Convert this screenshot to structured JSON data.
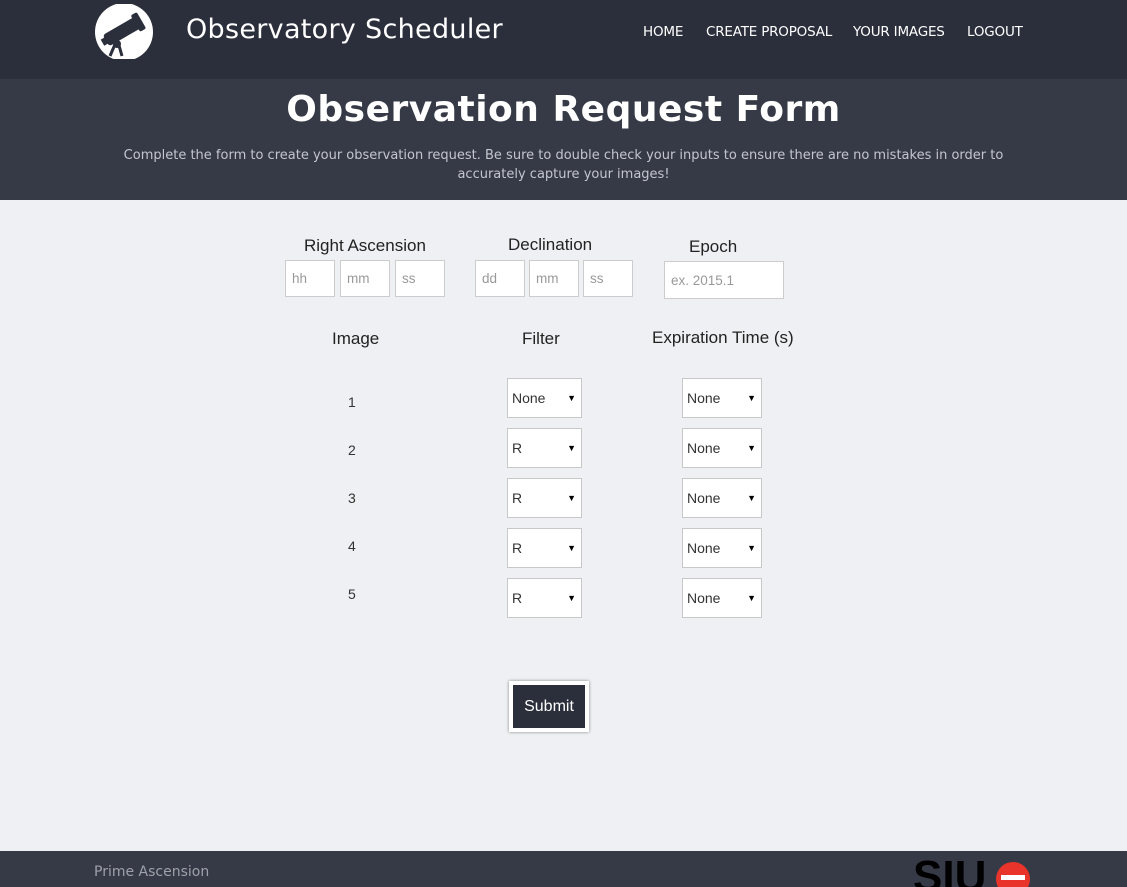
{
  "header": {
    "brand": "Observatory Scheduler",
    "logo_icon": "telescope-icon",
    "nav": [
      "HOME",
      "CREATE PROPOSAL",
      "YOUR IMAGES",
      "LOGOUT"
    ]
  },
  "banner": {
    "title": "Observation Request Form",
    "subtitle": "Complete the form to create your observation request.  Be sure to double check your inputs to ensure there are no mistakes in order to accurately capture your images!"
  },
  "coordinates": {
    "ra": {
      "label": "Right Ascension",
      "placeholders": [
        "hh",
        "mm",
        "ss"
      ]
    },
    "dec": {
      "label": "Declination",
      "placeholders": [
        "dd",
        "mm",
        "ss"
      ]
    },
    "epoch": {
      "label": "Epoch",
      "placeholder": "ex. 2015.1"
    }
  },
  "table": {
    "headers": [
      "Image",
      "Filter",
      "Expiration Time (s)"
    ],
    "rows": [
      {
        "image": "1",
        "filter": "None",
        "expiration": "None"
      },
      {
        "image": "2",
        "filter": "R",
        "expiration": "None"
      },
      {
        "image": "3",
        "filter": "R",
        "expiration": "None"
      },
      {
        "image": "4",
        "filter": "R",
        "expiration": "None"
      },
      {
        "image": "5",
        "filter": "R",
        "expiration": "None"
      }
    ]
  },
  "form": {
    "submit_label": "Submit"
  },
  "footer": {
    "text": "Prime Ascension",
    "logo_icon": "siue-logo",
    "logo_letters": "SIUe"
  },
  "colors": {
    "navbar": "#2b2e3b",
    "banner": "#363a47",
    "background": "#eff0f3",
    "accent_red": "#e8342a"
  }
}
